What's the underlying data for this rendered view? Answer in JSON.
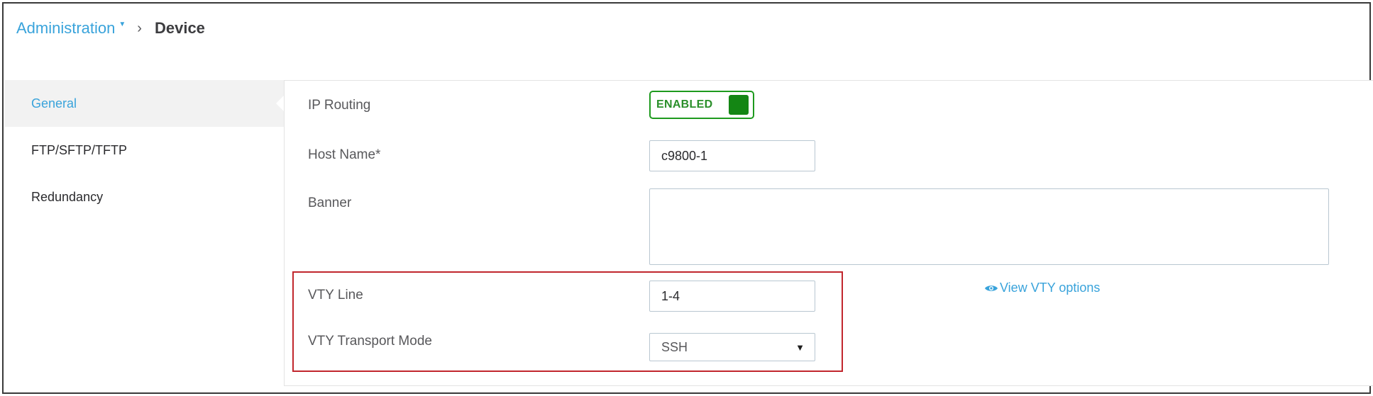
{
  "breadcrumb": {
    "parent": "Administration",
    "current": "Device"
  },
  "sidebar": {
    "items": [
      {
        "label": "General",
        "active": true
      },
      {
        "label": "FTP/SFTP/TFTP",
        "active": false
      },
      {
        "label": "Redundancy",
        "active": false
      }
    ]
  },
  "form": {
    "ip_routing": {
      "label": "IP Routing",
      "value": "ENABLED"
    },
    "host_name": {
      "label": "Host Name*",
      "value": "c9800-1"
    },
    "banner": {
      "label": "Banner",
      "value": ""
    },
    "vty_line": {
      "label": "VTY Line",
      "value": "1-4"
    },
    "vty_transport": {
      "label": "VTY Transport Mode",
      "value": "SSH"
    },
    "view_vty_options": "View VTY options"
  },
  "colors": {
    "accent": "#39a3db",
    "enabled_green": "#148614",
    "highlight_red": "#c1262d"
  }
}
